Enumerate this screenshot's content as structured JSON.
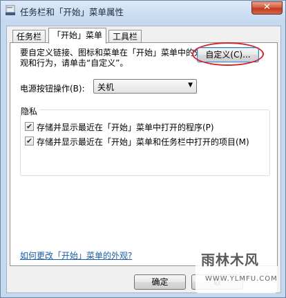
{
  "window": {
    "title": "任务栏和「开始」菜单属性",
    "close_label": "✕",
    "icon": "taskbar-properties-icon"
  },
  "tabs": [
    {
      "label": "任务栏",
      "active": false
    },
    {
      "label": "「开始」菜单",
      "active": true
    },
    {
      "label": "工具栏",
      "active": false
    }
  ],
  "start_menu": {
    "description": "要自定义链接、图标和菜单在「开始」菜单中的外观和行为，请单击“自定义”。",
    "customize_label": "自定义(C)...",
    "power_label": "电源按钮操作(B):",
    "power_value": "关机",
    "privacy": {
      "title": "隐私",
      "items": [
        {
          "label": "存储并显示最近在「开始」菜单中打开的程序(P)",
          "checked": true
        },
        {
          "label": "存储并显示最近在「开始」菜单和任务栏中打开的项目(M)",
          "checked": true
        }
      ]
    },
    "help_link": "如何更改「开始」菜单的外观?"
  },
  "buttons": {
    "ok": "确定",
    "cancel": "取"
  },
  "watermark": {
    "brand": "雨林木风",
    "url": "WWW.YLMFU.COM"
  },
  "colors": {
    "highlight_oval": "#d8232a",
    "link": "#1a5ea8"
  }
}
